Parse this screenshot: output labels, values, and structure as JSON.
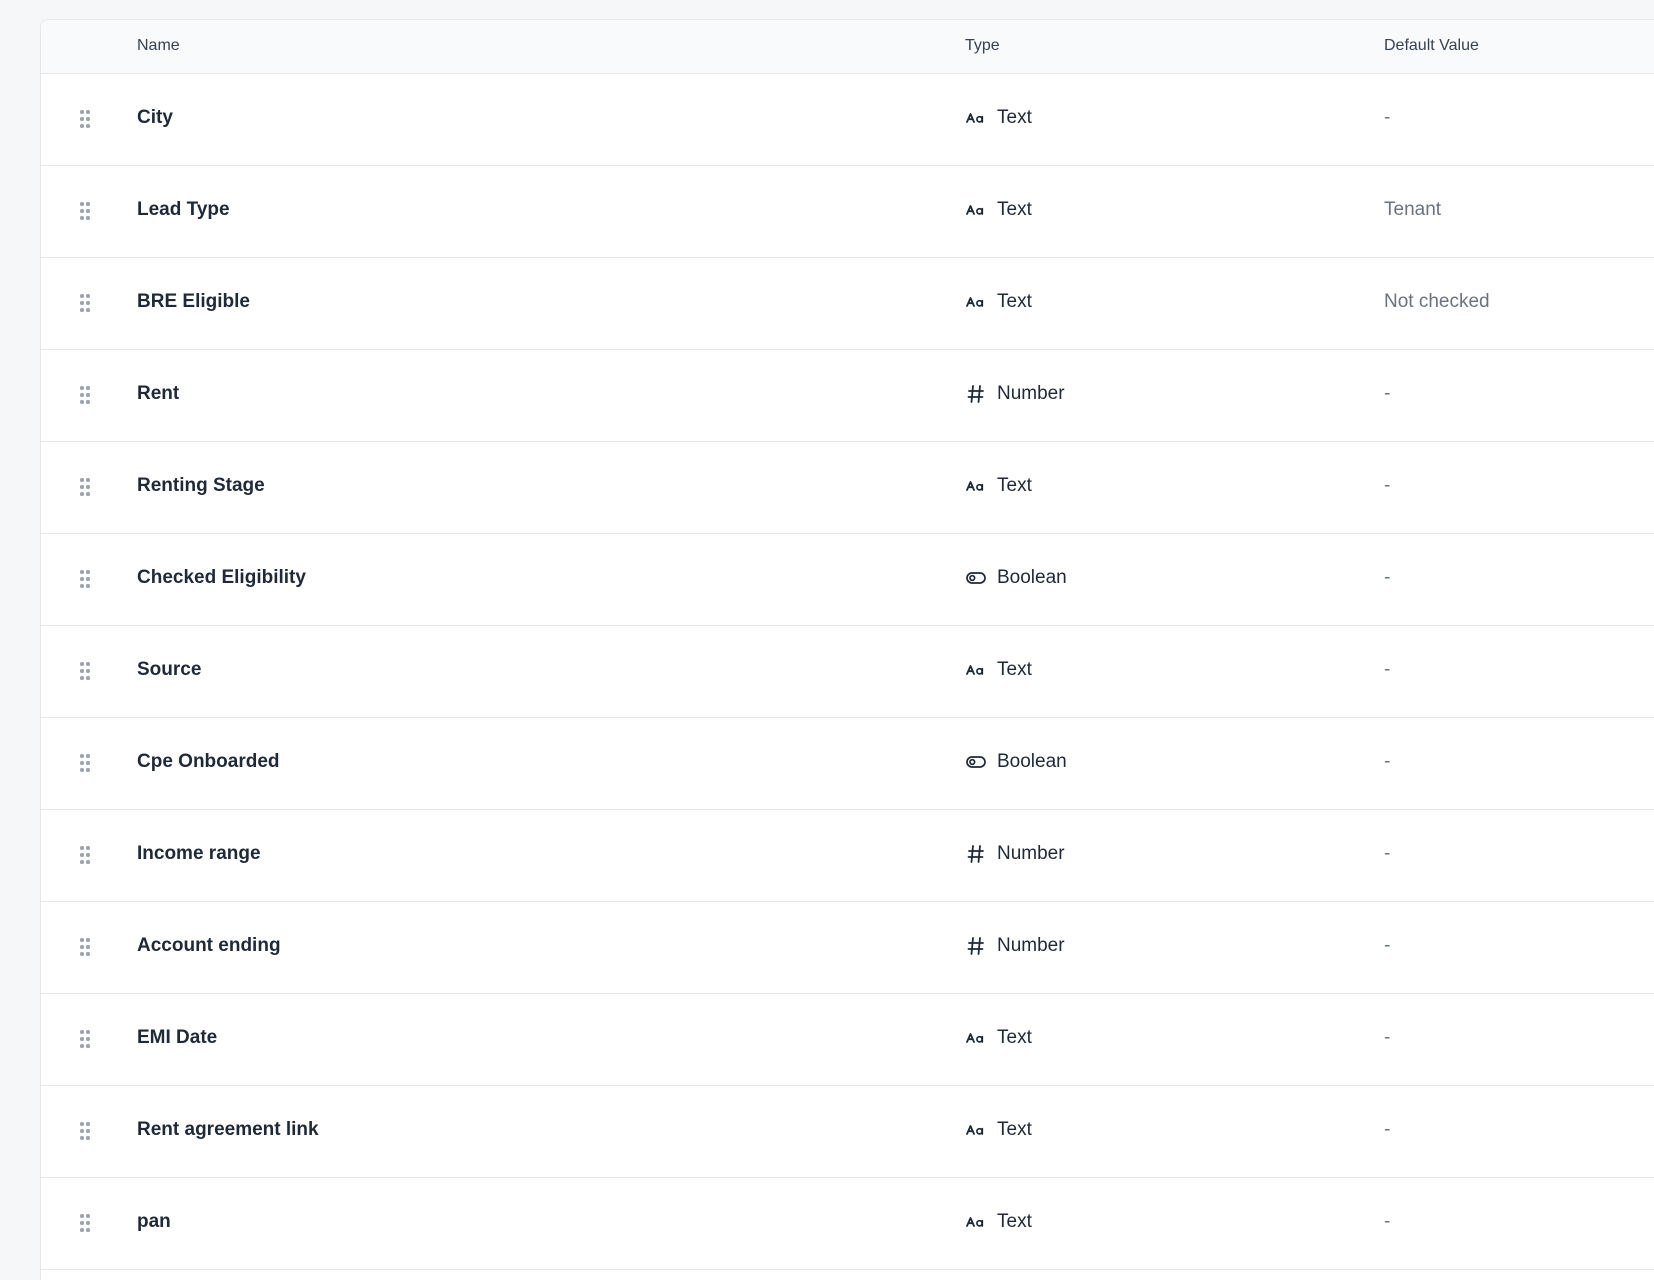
{
  "table": {
    "columns": {
      "name": "Name",
      "type": "Type",
      "default": "Default Value"
    },
    "rows": [
      {
        "name": "City",
        "type": "Text",
        "type_icon": "text-type-icon",
        "default": "-"
      },
      {
        "name": "Lead Type",
        "type": "Text",
        "type_icon": "text-type-icon",
        "default": "Tenant"
      },
      {
        "name": "BRE Eligible",
        "type": "Text",
        "type_icon": "text-type-icon",
        "default": "Not checked"
      },
      {
        "name": "Rent",
        "type": "Number",
        "type_icon": "hash-icon",
        "default": "-"
      },
      {
        "name": "Renting Stage",
        "type": "Text",
        "type_icon": "text-type-icon",
        "default": "-"
      },
      {
        "name": "Checked Eligibility",
        "type": "Boolean",
        "type_icon": "toggle-icon",
        "default": "-"
      },
      {
        "name": "Source",
        "type": "Text",
        "type_icon": "text-type-icon",
        "default": "-"
      },
      {
        "name": "Cpe Onboarded",
        "type": "Boolean",
        "type_icon": "toggle-icon",
        "default": "-"
      },
      {
        "name": "Income range",
        "type": "Number",
        "type_icon": "hash-icon",
        "default": "-"
      },
      {
        "name": "Account ending",
        "type": "Number",
        "type_icon": "hash-icon",
        "default": "-"
      },
      {
        "name": "EMI Date",
        "type": "Text",
        "type_icon": "text-type-icon",
        "default": "-"
      },
      {
        "name": "Rent agreement link",
        "type": "Text",
        "type_icon": "text-type-icon",
        "default": "-"
      },
      {
        "name": "pan",
        "type": "Text",
        "type_icon": "text-type-icon",
        "default": "-"
      }
    ]
  }
}
